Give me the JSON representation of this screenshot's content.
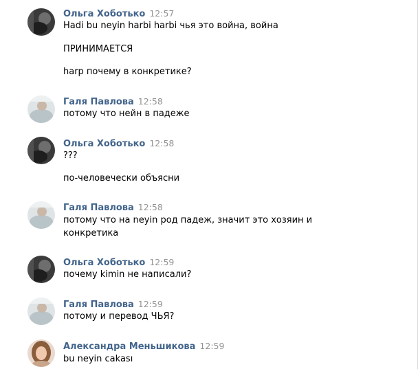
{
  "messages": [
    {
      "author": "Ольга Хоботько",
      "time": "12:57",
      "avatar_icon": "dark-photo-avatar-icon",
      "lines": [
        "Hadi bu neyin harbi harbi чья это война, война",
        "ПРИНИМАЕТСЯ",
        "harp почему в конкретике?"
      ]
    },
    {
      "author": "Галя Павлова",
      "time": "12:58",
      "avatar_icon": "light-photo-avatar-icon",
      "lines": [
        "потому что нейн в падеже"
      ]
    },
    {
      "author": "Ольга Хоботько",
      "time": "12:58",
      "avatar_icon": "dark-photo-avatar-icon",
      "lines": [
        "???",
        "по-человечески объясни"
      ]
    },
    {
      "author": "Галя Павлова",
      "time": "12:58",
      "avatar_icon": "light-photo-avatar-icon",
      "lines": [
        "потому что на neyin род падеж, значит это хозяин и",
        "конкретика"
      ]
    },
    {
      "author": "Ольга Хоботько",
      "time": "12:59",
      "avatar_icon": "dark-photo-avatar-icon",
      "lines": [
        "почему kimin не написали?"
      ]
    },
    {
      "author": "Галя Павлова",
      "time": "12:59",
      "avatar_icon": "light-photo-avatar-icon",
      "lines": [
        "потому и перевод ЧЬЯ?"
      ]
    },
    {
      "author": "Александра Меньшикова",
      "time": "12:59",
      "avatar_icon": "portrait-photo-avatar-icon",
      "lines": [
        "bu neyin cakası"
      ]
    }
  ],
  "colors": {
    "author": "#42648b",
    "timestamp": "#939393",
    "text": "#000000",
    "background": "#ffffff"
  }
}
